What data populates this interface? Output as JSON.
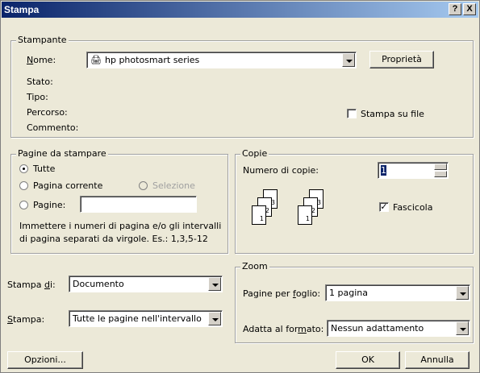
{
  "window": {
    "title": "Stampa",
    "help_btn": "?",
    "close_btn": "X"
  },
  "printer": {
    "legend": "Stampante",
    "name_label": "Nome:",
    "name_value": "hp photosmart series",
    "properties_btn": "Proprietà",
    "status_label": "Stato:",
    "type_label": "Tipo:",
    "path_label": "Percorso:",
    "comment_label": "Commento:",
    "print_to_file": "Stampa su file",
    "print_to_file_checked": false
  },
  "pages": {
    "legend": "Pagine da stampare",
    "all": "Tutte",
    "current": "Pagina corrente",
    "selection": "Selezione",
    "pages": "Pagine:",
    "pages_value": "",
    "selected_option": "all",
    "hint_line1": "Immettere i numeri di pagina e/o gli intervalli",
    "hint_line2": "di pagina separati da virgole. Es.: 1,3,5-12"
  },
  "copies": {
    "legend": "Copie",
    "count_label": "Numero di copie:",
    "count_value": "1",
    "collate_label": "Fascicola",
    "collate_checked": true,
    "page_nums": [
      "1",
      "2",
      "3"
    ]
  },
  "print_what": {
    "label": "Stampa di:",
    "value": "Documento"
  },
  "print_range": {
    "label": "Stampa:",
    "value": "Tutte le pagine nell'intervallo"
  },
  "zoom": {
    "legend": "Zoom",
    "pages_per_sheet_label": "Pagine per foglio:",
    "pages_per_sheet_value": "1 pagina",
    "scale_label": "Adatta al formato:",
    "scale_value": "Nessun adattamento"
  },
  "footer": {
    "options": "Opzioni...",
    "ok": "OK",
    "cancel": "Annulla"
  }
}
